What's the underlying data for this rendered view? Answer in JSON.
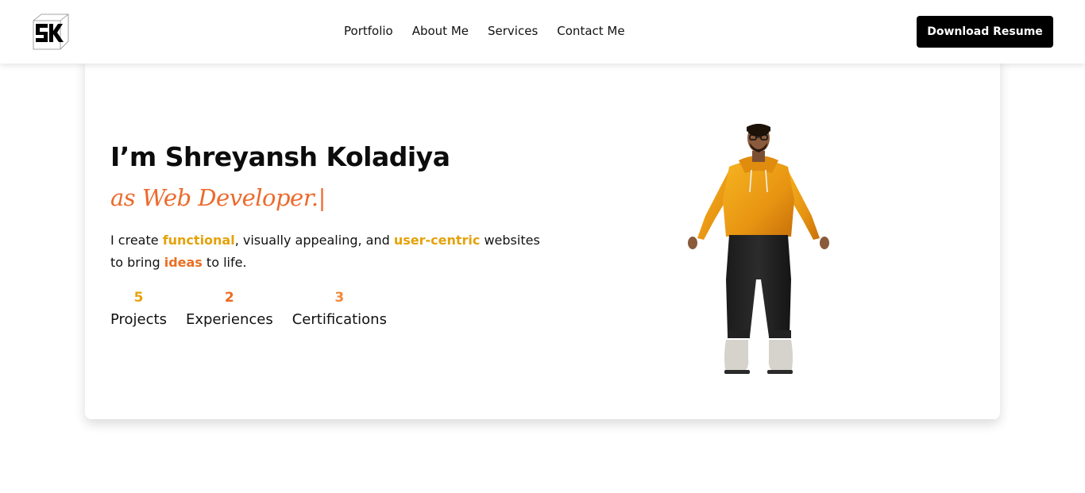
{
  "header": {
    "logo_text": "SK",
    "nav": [
      "Portfolio",
      "About Me",
      "Services",
      "Contact Me"
    ],
    "resume_button": "Download Resume"
  },
  "hero": {
    "title": "I’m Shreyansh Koladiya",
    "role": "as Web Developer.",
    "caret": "|",
    "desc_parts": {
      "p1": "I create ",
      "h1": "functional",
      "p2": ", visually appealing, and ",
      "h2": "user-centric",
      "p3": " websites to bring ",
      "h3": "ideas",
      "p4": " to life."
    },
    "stats": [
      {
        "num": "5",
        "label": "Projects",
        "color": "#e8a10a"
      },
      {
        "num": "2",
        "label": "Experiences",
        "color": "#ec6a1e"
      },
      {
        "num": "3",
        "label": "Certifications",
        "color": "#f08a3c"
      }
    ]
  },
  "colors": {
    "accent_yellow": "#e4a20b",
    "accent_orange": "#ea6f24",
    "hoodie": "#f0a11a"
  }
}
